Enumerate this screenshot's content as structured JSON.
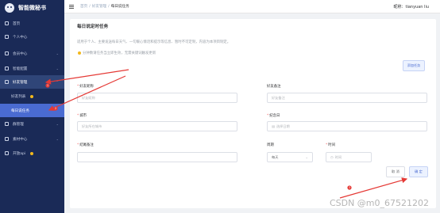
{
  "app": {
    "title": "智能微秘书"
  },
  "sidebar": {
    "items": [
      {
        "label": "首页",
        "chevron": false
      },
      {
        "label": "个人中心",
        "chevron": false
      },
      {
        "label": "会员中心",
        "chevron": true
      },
      {
        "label": "智能配置",
        "chevron": true
      },
      {
        "label": "好友管理",
        "chevron": true
      },
      {
        "label": "好友列表",
        "chevron": false
      },
      {
        "label": "每日说任务",
        "chevron": false
      },
      {
        "label": "群管理",
        "chevron": true
      },
      {
        "label": "素材中心",
        "chevron": true
      },
      {
        "label": "开放api",
        "chevron": false
      }
    ]
  },
  "breadcrumb": {
    "items": [
      "首页",
      "好友管理",
      "每日说任务"
    ]
  },
  "user": {
    "name": "昵称：tianyuan liu"
  },
  "card": {
    "title": "每日说定时任务",
    "description": "适用于个人、主要发送每日天气、一句暖心情话和提示等信息、暂时不可定制，内容为本项目制定。",
    "note": "分钟数请任务当立即生效，无需关键词触发更新",
    "add_button": "添加任务"
  },
  "form": {
    "friend_nickname": {
      "label": "好友昵称",
      "placeholder": "好友昵称"
    },
    "friend_remark": {
      "label": "好友备注",
      "placeholder": "好友备注"
    },
    "city": {
      "label": "城市",
      "placeholder": "好友所在城市"
    },
    "anniversary": {
      "label": "纪念日",
      "placeholder": "选择日期"
    },
    "closing_remark": {
      "label": "结尾备注",
      "placeholder": ""
    },
    "cycle": {
      "label": "周期",
      "value": "每天"
    },
    "time": {
      "label": "时间",
      "placeholder": "时间"
    }
  },
  "actions": {
    "cancel": "取 消",
    "confirm": "确 定"
  },
  "annotations": {
    "badges": [
      "1",
      "2",
      "3"
    ]
  },
  "watermark": "CSDN @m0_67521202",
  "colors": {
    "sidebar_bg": "#1a2a57",
    "accent": "#4a6bd1",
    "arrow": "#e53935"
  }
}
